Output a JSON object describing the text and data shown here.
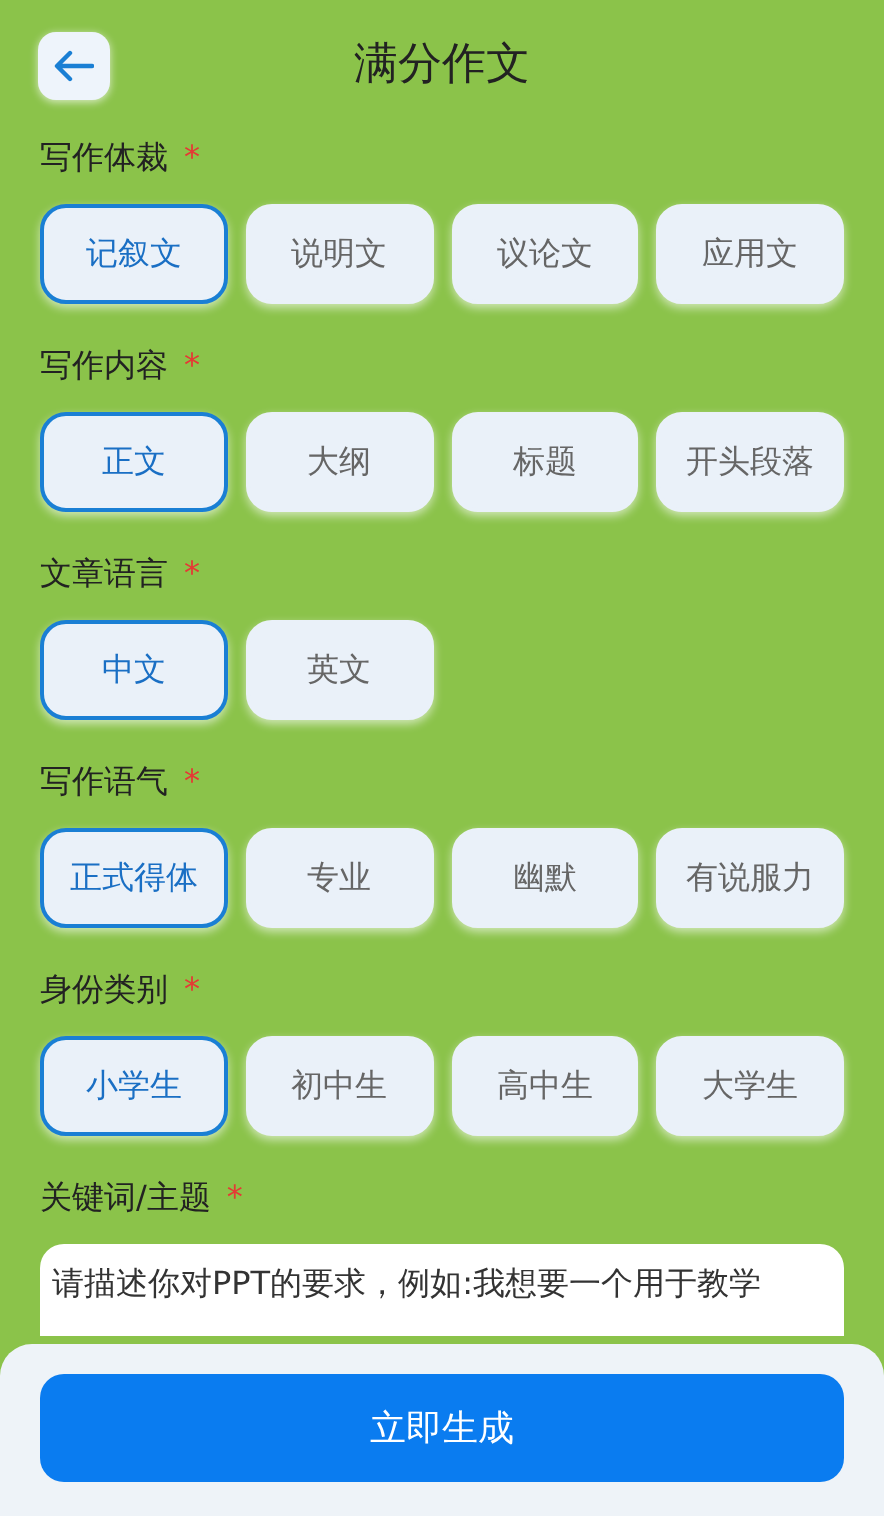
{
  "header": {
    "title": "满分作文"
  },
  "sections": [
    {
      "label": "写作体裁",
      "required_mark": "*",
      "options": [
        {
          "label": "记叙文",
          "selected": true
        },
        {
          "label": "说明文",
          "selected": false
        },
        {
          "label": "议论文",
          "selected": false
        },
        {
          "label": "应用文",
          "selected": false
        }
      ]
    },
    {
      "label": "写作内容",
      "required_mark": "*",
      "options": [
        {
          "label": "正文",
          "selected": true
        },
        {
          "label": "大纲",
          "selected": false
        },
        {
          "label": "标题",
          "selected": false
        },
        {
          "label": "开头段落",
          "selected": false
        }
      ]
    },
    {
      "label": "文章语言",
      "required_mark": "*",
      "options": [
        {
          "label": "中文",
          "selected": true
        },
        {
          "label": "英文",
          "selected": false
        }
      ]
    },
    {
      "label": "写作语气",
      "required_mark": "*",
      "options": [
        {
          "label": "正式得体",
          "selected": true
        },
        {
          "label": "专业",
          "selected": false
        },
        {
          "label": "幽默",
          "selected": false
        },
        {
          "label": "有说服力",
          "selected": false
        }
      ]
    },
    {
      "label": "身份类别",
      "required_mark": "*",
      "options": [
        {
          "label": "小学生",
          "selected": true
        },
        {
          "label": "初中生",
          "selected": false
        },
        {
          "label": "高中生",
          "selected": false
        },
        {
          "label": "大学生",
          "selected": false
        }
      ]
    }
  ],
  "keyword": {
    "label": "关键词/主题",
    "required_mark": "*",
    "placeholder": "请描述你对PPT的要求，例如:我想要一个用于教学"
  },
  "generate_button": "立即生成"
}
